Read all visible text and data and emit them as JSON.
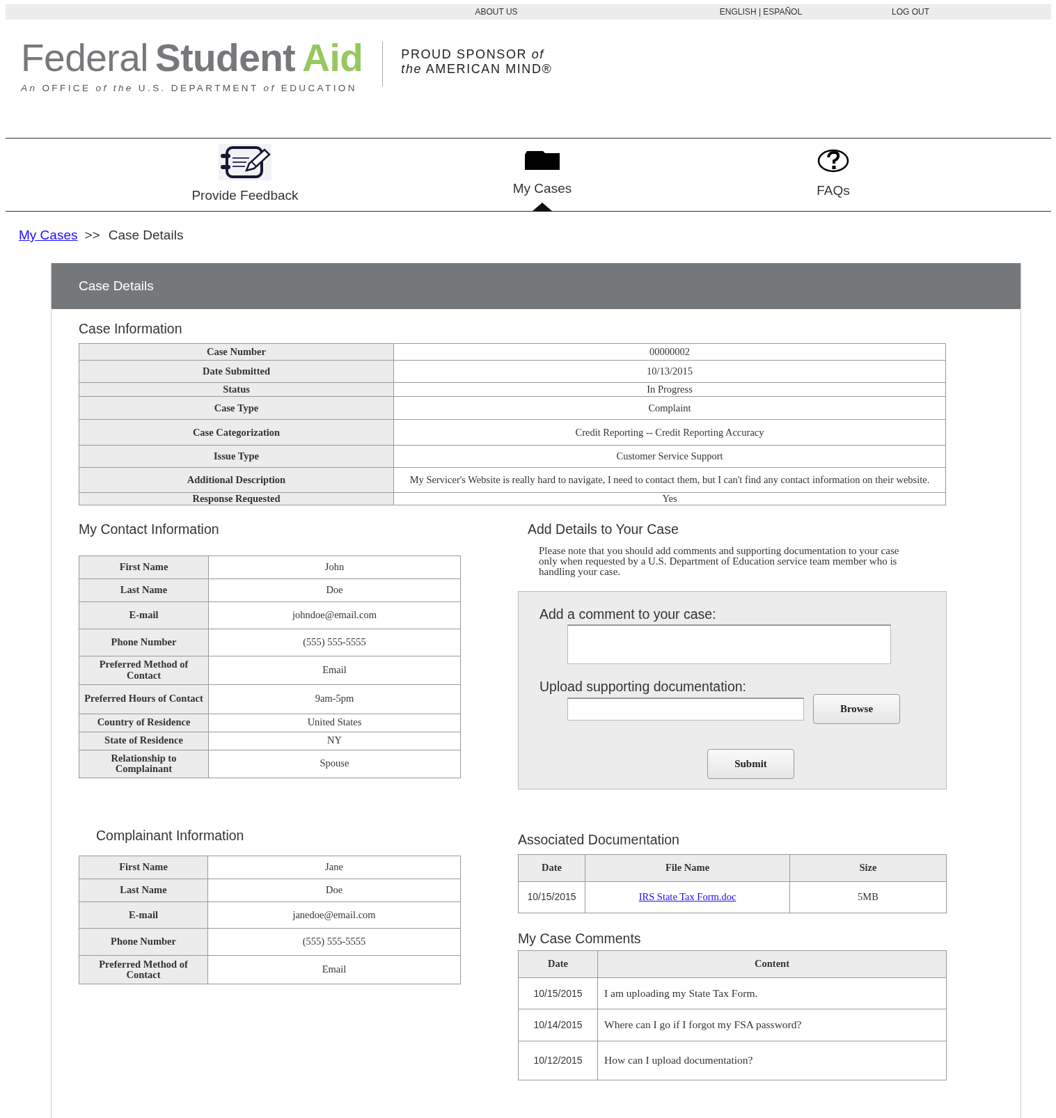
{
  "top_links": [
    "ABOUT US",
    "ENGLISH | ESPAÑOL",
    "LOG OUT"
  ],
  "logo": {
    "name_parts": [
      "Federal",
      "Student",
      "Aid"
    ],
    "tagline": "*An* OFFICE *of the* U.S. DEPARTMENT *of* EDUCATION",
    "sponsor_lines": [
      "PROUD SPONSOR *of*",
      "*the* AMERICAN MIND®"
    ]
  },
  "nav": [
    {
      "label": "Provide Feedback",
      "selected": false
    },
    {
      "label": "My Cases",
      "selected": true
    },
    {
      "label": "FAQs",
      "selected": false
    }
  ],
  "breadcrumb": {
    "link": "My Cases",
    "separator": ">>",
    "current": "Case Details"
  },
  "panel_title": "Case Details",
  "case_information": {
    "title": "Case Information",
    "rows": [
      {
        "label": "Case Number",
        "value": "00000002"
      },
      {
        "label": "Date Submitted",
        "value": "10/13/2015"
      },
      {
        "label": "Status",
        "value": "In Progress"
      },
      {
        "label": "Case Type",
        "value": "Complaint"
      },
      {
        "label": "Case Categorization",
        "value": "Credit Reporting -- Credit Reporting Accuracy"
      },
      {
        "label": "Issue Type",
        "value": "Customer Service Support"
      },
      {
        "label": "Additional Description",
        "value": "My Servicer's Website is really hard to navigate, I need to contact them, but I can't find any contact information on their website."
      },
      {
        "label": "Response Requested",
        "value": "Yes"
      }
    ]
  },
  "contact_information": {
    "title": "My Contact Information",
    "rows": [
      {
        "label": "First Name",
        "value": "John"
      },
      {
        "label": "Last Name",
        "value": "Doe"
      },
      {
        "label": "E-mail",
        "value": "johndoe@email.com"
      },
      {
        "label": "Phone Number",
        "value": "(555) 555-5555"
      },
      {
        "label": "Preferred Method of Contact",
        "value": "Email"
      },
      {
        "label": "Preferred Hours of Contact",
        "value": "9am-5pm"
      },
      {
        "label": "Country of Residence",
        "value": "United States"
      },
      {
        "label": "State of Residence",
        "value": "NY"
      },
      {
        "label": "Relationship to Complainant",
        "value": "Spouse"
      }
    ]
  },
  "complainant_information": {
    "title": "Complainant Information",
    "rows": [
      {
        "label": "First Name",
        "value": "Jane"
      },
      {
        "label": "Last Name",
        "value": "Doe"
      },
      {
        "label": "E-mail",
        "value": "janedoe@email.com"
      },
      {
        "label": "Phone Number",
        "value": "(555) 555-5555"
      },
      {
        "label": "Preferred Method of Contact",
        "value": "Email"
      }
    ]
  },
  "add_details": {
    "title": "Add Details to Your Case",
    "note": "Please note that you should add comments and supporting documentation to your case only when requested by a U.S. Department of Education service team member who is handling your case.",
    "comment_label": "Add a comment to your case:",
    "upload_label": "Upload supporting documentation:",
    "browse_button": "Browse",
    "submit_button": "Submit"
  },
  "associated_documentation": {
    "title": "Associated Documentation",
    "columns": [
      "Date",
      "File Name",
      "Size"
    ],
    "rows": [
      {
        "date": "10/15/2015",
        "file_name": "IRS State Tax Form.doc",
        "size": "5MB"
      }
    ]
  },
  "case_comments": {
    "title": "My Case Comments",
    "columns": [
      "Date",
      "Content"
    ],
    "rows": [
      {
        "date": "10/15/2015",
        "content": "I am uploading my State Tax Form."
      },
      {
        "date": "10/14/2015",
        "content": "Where can I go if I forgot my FSA password?"
      },
      {
        "date": "10/12/2015",
        "content": "How can I upload documentation?"
      }
    ]
  }
}
